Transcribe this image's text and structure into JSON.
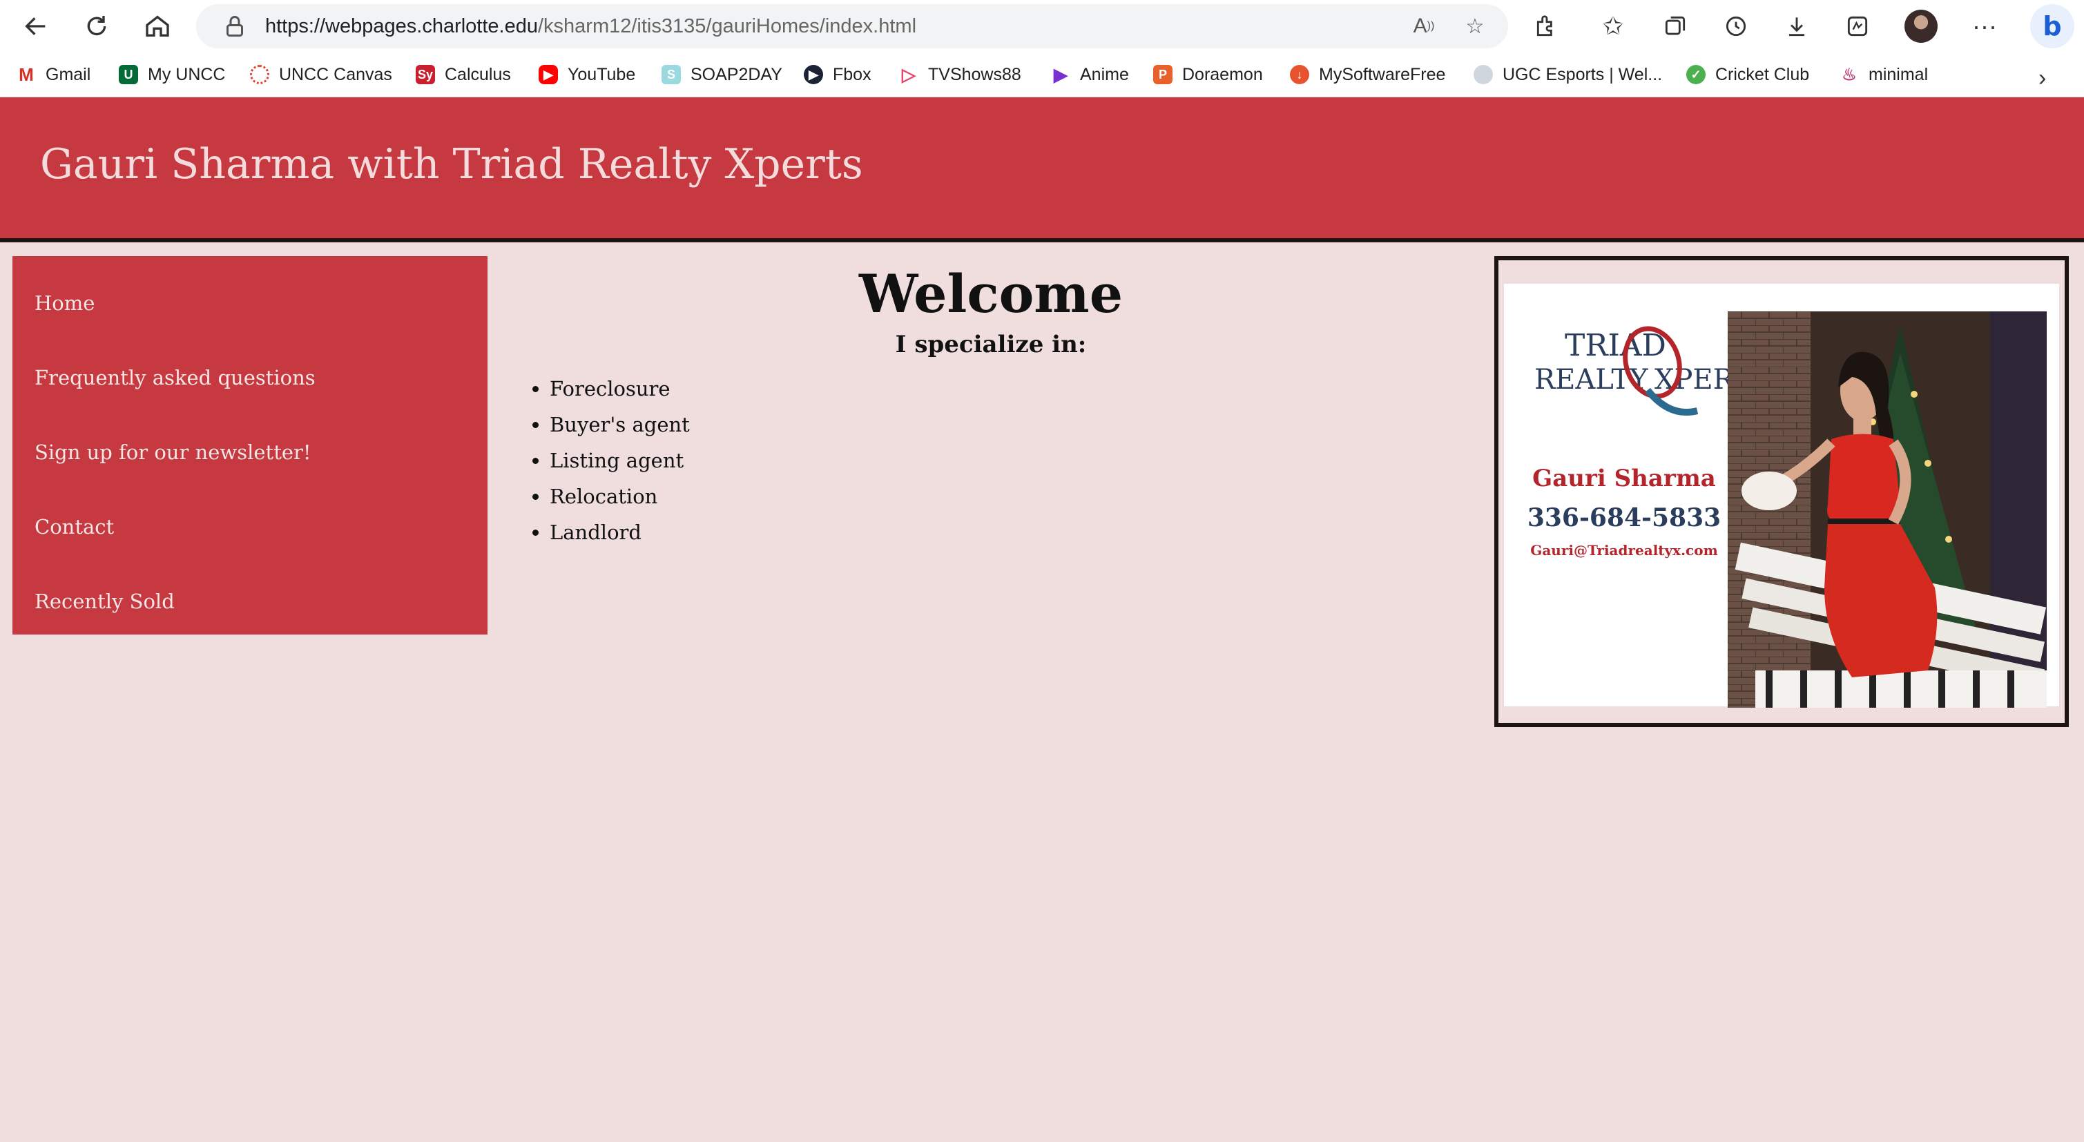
{
  "browser": {
    "url_host": "https://webpages.charlotte.edu",
    "url_path": "/ksharm12/itis3135/gauriHomes/index.html",
    "bookmarks": [
      {
        "label": "Gmail",
        "icon": "gmail-icon",
        "color": "#d93025"
      },
      {
        "label": "My UNCC",
        "icon": "uncc-icon",
        "color": "#046a38"
      },
      {
        "label": "UNCC Canvas",
        "icon": "canvas-icon",
        "color": "#e13f2b"
      },
      {
        "label": "Calculus",
        "icon": "calculus-icon",
        "color": "#c8202f"
      },
      {
        "label": "YouTube",
        "icon": "youtube-icon",
        "color": "#ff0000"
      },
      {
        "label": "SOAP2DAY",
        "icon": "soap2day-icon",
        "color": "#9ad9e0"
      },
      {
        "label": "Fbox",
        "icon": "fbox-icon",
        "color": "#1c2235"
      },
      {
        "label": "TVShows88",
        "icon": "tvshows88-icon",
        "color": "#e7436b"
      },
      {
        "label": "Anime",
        "icon": "anime-icon",
        "color": "#7a2fd1"
      },
      {
        "label": "Doraemon",
        "icon": "doraemon-icon",
        "color": "#e8612c"
      },
      {
        "label": "MySoftwareFree",
        "icon": "mysoftwarefree-icon",
        "color": "#e8532f"
      },
      {
        "label": "UGC Esports | Wel...",
        "icon": "ugc-esports-icon",
        "color": "#cfd6dd"
      },
      {
        "label": "Cricket Club",
        "icon": "cricket-club-icon",
        "color": "#4caf50"
      },
      {
        "label": "minimal",
        "icon": "minimal-icon",
        "color": "#c1447a"
      }
    ]
  },
  "site": {
    "title": "Gauri Sharma with Triad Realty Xperts",
    "nav": [
      "Home",
      "Frequently asked questions",
      "Sign up for our newsletter!",
      "Contact",
      "Recently Sold"
    ],
    "welcome": "Welcome",
    "specialize": "I specialize in:",
    "specialties": [
      "Foreclosure",
      "Buyer's agent",
      "Listing agent",
      "Relocation",
      "Landlord"
    ],
    "card": {
      "logo_line1": "TRIAD",
      "logo_line2": "REALTY",
      "logo_line3": "XPERTS",
      "name": "Gauri Sharma",
      "phone": "336-684-5833",
      "email": "Gauri@Triadrealtyx.com"
    }
  },
  "colors": {
    "header_bg": "#c63940",
    "page_bg": "#f0dede",
    "header_text": "#f4dcdc",
    "nav_text": "#f6e6e6"
  }
}
